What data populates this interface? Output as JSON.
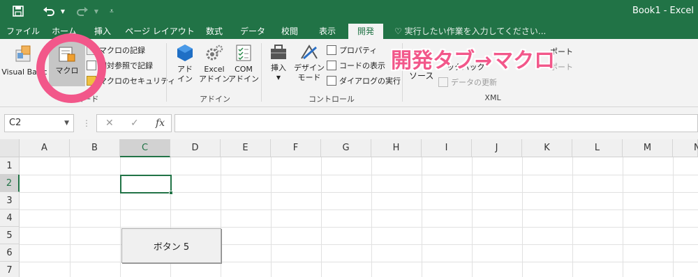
{
  "titlebar": {
    "title": "Book1 - Excel",
    "save_icon": "save-icon",
    "undo_icon": "undo-icon",
    "redo_icon": "redo-icon",
    "customize_icon": "customize-qat-icon"
  },
  "tabs": [
    "ファイル",
    "ホーム",
    "挿入",
    "ページ レイアウト",
    "数式",
    "データ",
    "校閲",
    "表示",
    "開発"
  ],
  "active_tab": "開発",
  "tellme": "実行したい作業を入力してください...",
  "ribbon": {
    "code": {
      "visual_basic": "Visual Basic",
      "macro": "マクロ",
      "record_macro": "マクロの記録",
      "relative_ref": "相対参照で記録",
      "macro_security": "マクロのセキュリティ",
      "group_label": "コード"
    },
    "addins": {
      "addins": "アド\nイン",
      "addins_l1": "アド",
      "addins_l2": "イン",
      "excel_l1": "Excel",
      "excel_l2": "アドイン",
      "com_l1": "COM",
      "com_l2": "アドイン",
      "group_label": "アドイン"
    },
    "controls": {
      "insert": "挿入",
      "design_l1": "デザイン",
      "design_l2": "モード",
      "properties": "プロパティ",
      "view_code": "コードの表示",
      "run_dialog": "ダイアログの実行",
      "group_label": "コントロール"
    },
    "xml": {
      "source": "ソース",
      "refresh_data": "データの更新",
      "import": "ポート",
      "export": "ポート",
      "expansion": "ックパック",
      "group_label": "XML"
    }
  },
  "formula_bar": {
    "name_box": "C2",
    "cancel": "✕",
    "enter": "✓",
    "fx": "fx",
    "formula": ""
  },
  "grid": {
    "columns": [
      "A",
      "B",
      "C",
      "D",
      "E",
      "F",
      "G",
      "H",
      "I",
      "J",
      "K",
      "L",
      "M",
      "N"
    ],
    "rows": [
      "1",
      "2",
      "3",
      "4",
      "5",
      "6",
      "7"
    ],
    "selected_column": "C",
    "selected_row": "2",
    "sheet_button_label": "ボタン 5"
  },
  "annotation": {
    "text": "開発タブ→マクロ",
    "color": "#f2578a"
  },
  "colors": {
    "excel_green": "#217346",
    "ribbon_bg": "#f3f3f3",
    "annotation_pink": "#f2578a"
  }
}
